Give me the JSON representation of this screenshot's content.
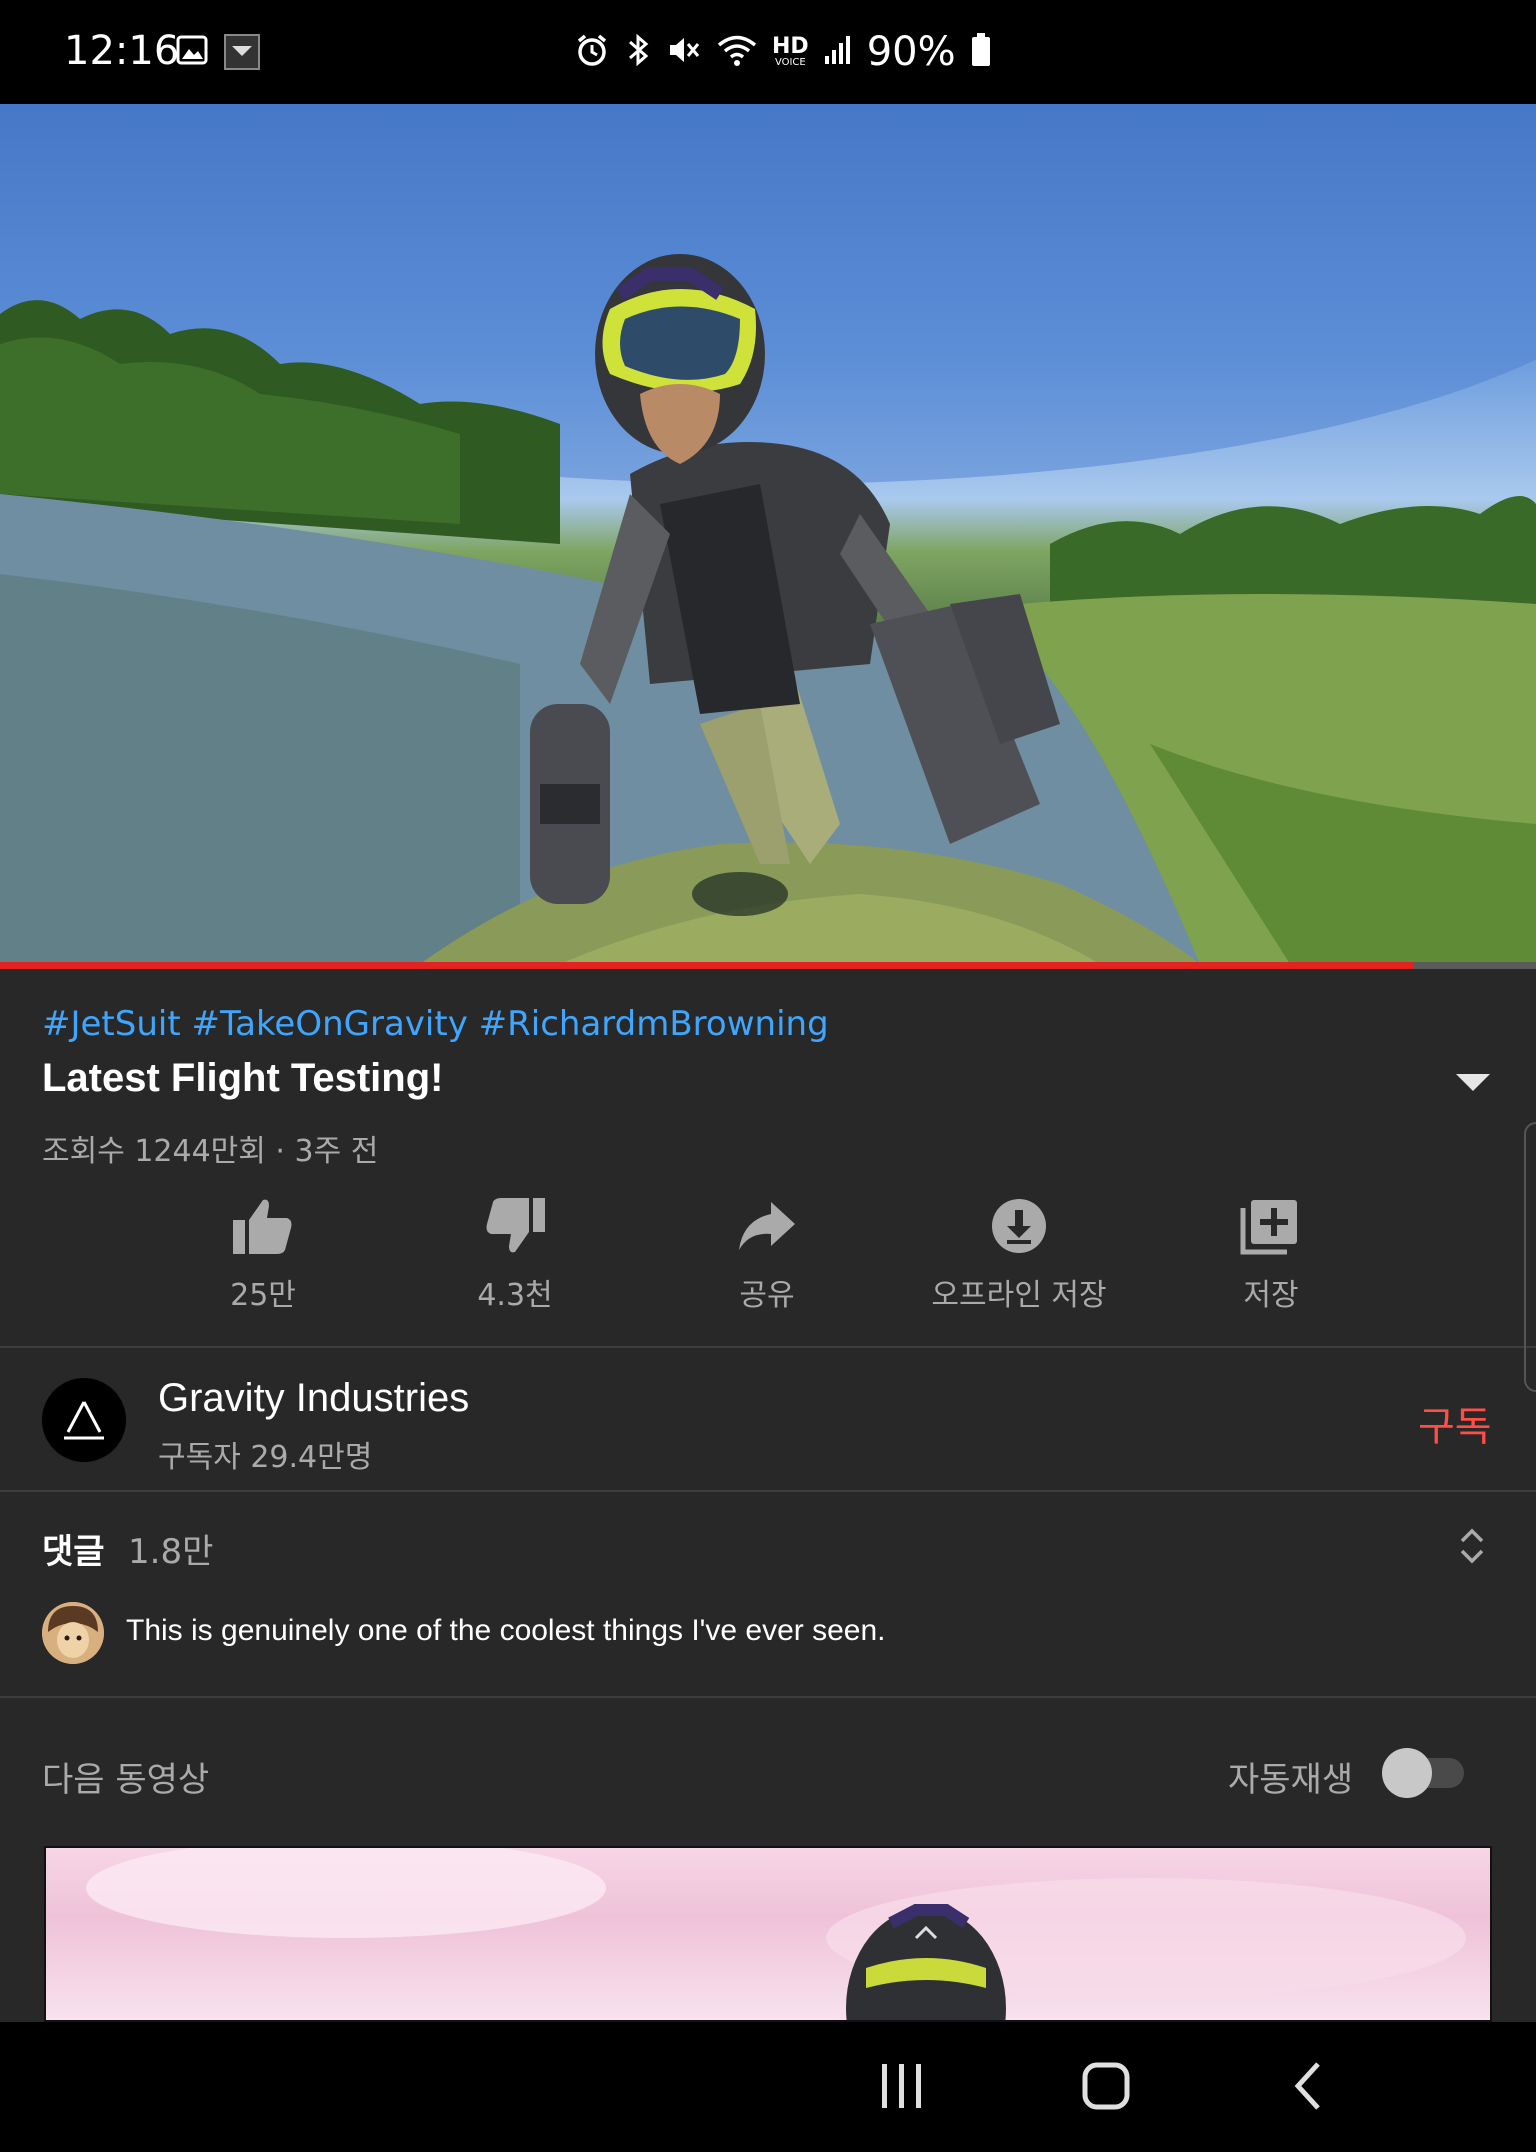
{
  "status_bar": {
    "time": "12:16",
    "battery": "90%",
    "hd_label": "HD",
    "voice_label": "VOICE"
  },
  "video": {
    "progress_fraction": 0.92
  },
  "info": {
    "hashtags": "#JetSuit #TakeOnGravity #RichardmBrowning",
    "title": "Latest Flight Testing!",
    "views_meta": "조회수 1244만회 · 3주 전"
  },
  "actions": [
    {
      "label": "25만",
      "icon": "thumb-up-icon"
    },
    {
      "label": "4.3천",
      "icon": "thumb-down-icon"
    },
    {
      "label": "공유",
      "icon": "share-icon"
    },
    {
      "label": "오프라인 저장",
      "icon": "download-icon"
    },
    {
      "label": "저장",
      "icon": "playlist-add-icon"
    }
  ],
  "channel": {
    "name": "Gravity Industries",
    "subscribers": "구독자 29.4만명",
    "subscribe_label": "구독"
  },
  "comments": {
    "label": "댓글",
    "count": "1.8만",
    "top_comment": "This is genuinely one of the coolest things I've ever seen."
  },
  "up_next": {
    "label": "다음 동영상",
    "autoplay_label": "자동재생",
    "autoplay_on": false
  },
  "colors": {
    "background": "#282828",
    "link_blue": "#3ea6ff",
    "subscribe_red": "#ff4e45",
    "progress_red": "#e32222"
  }
}
